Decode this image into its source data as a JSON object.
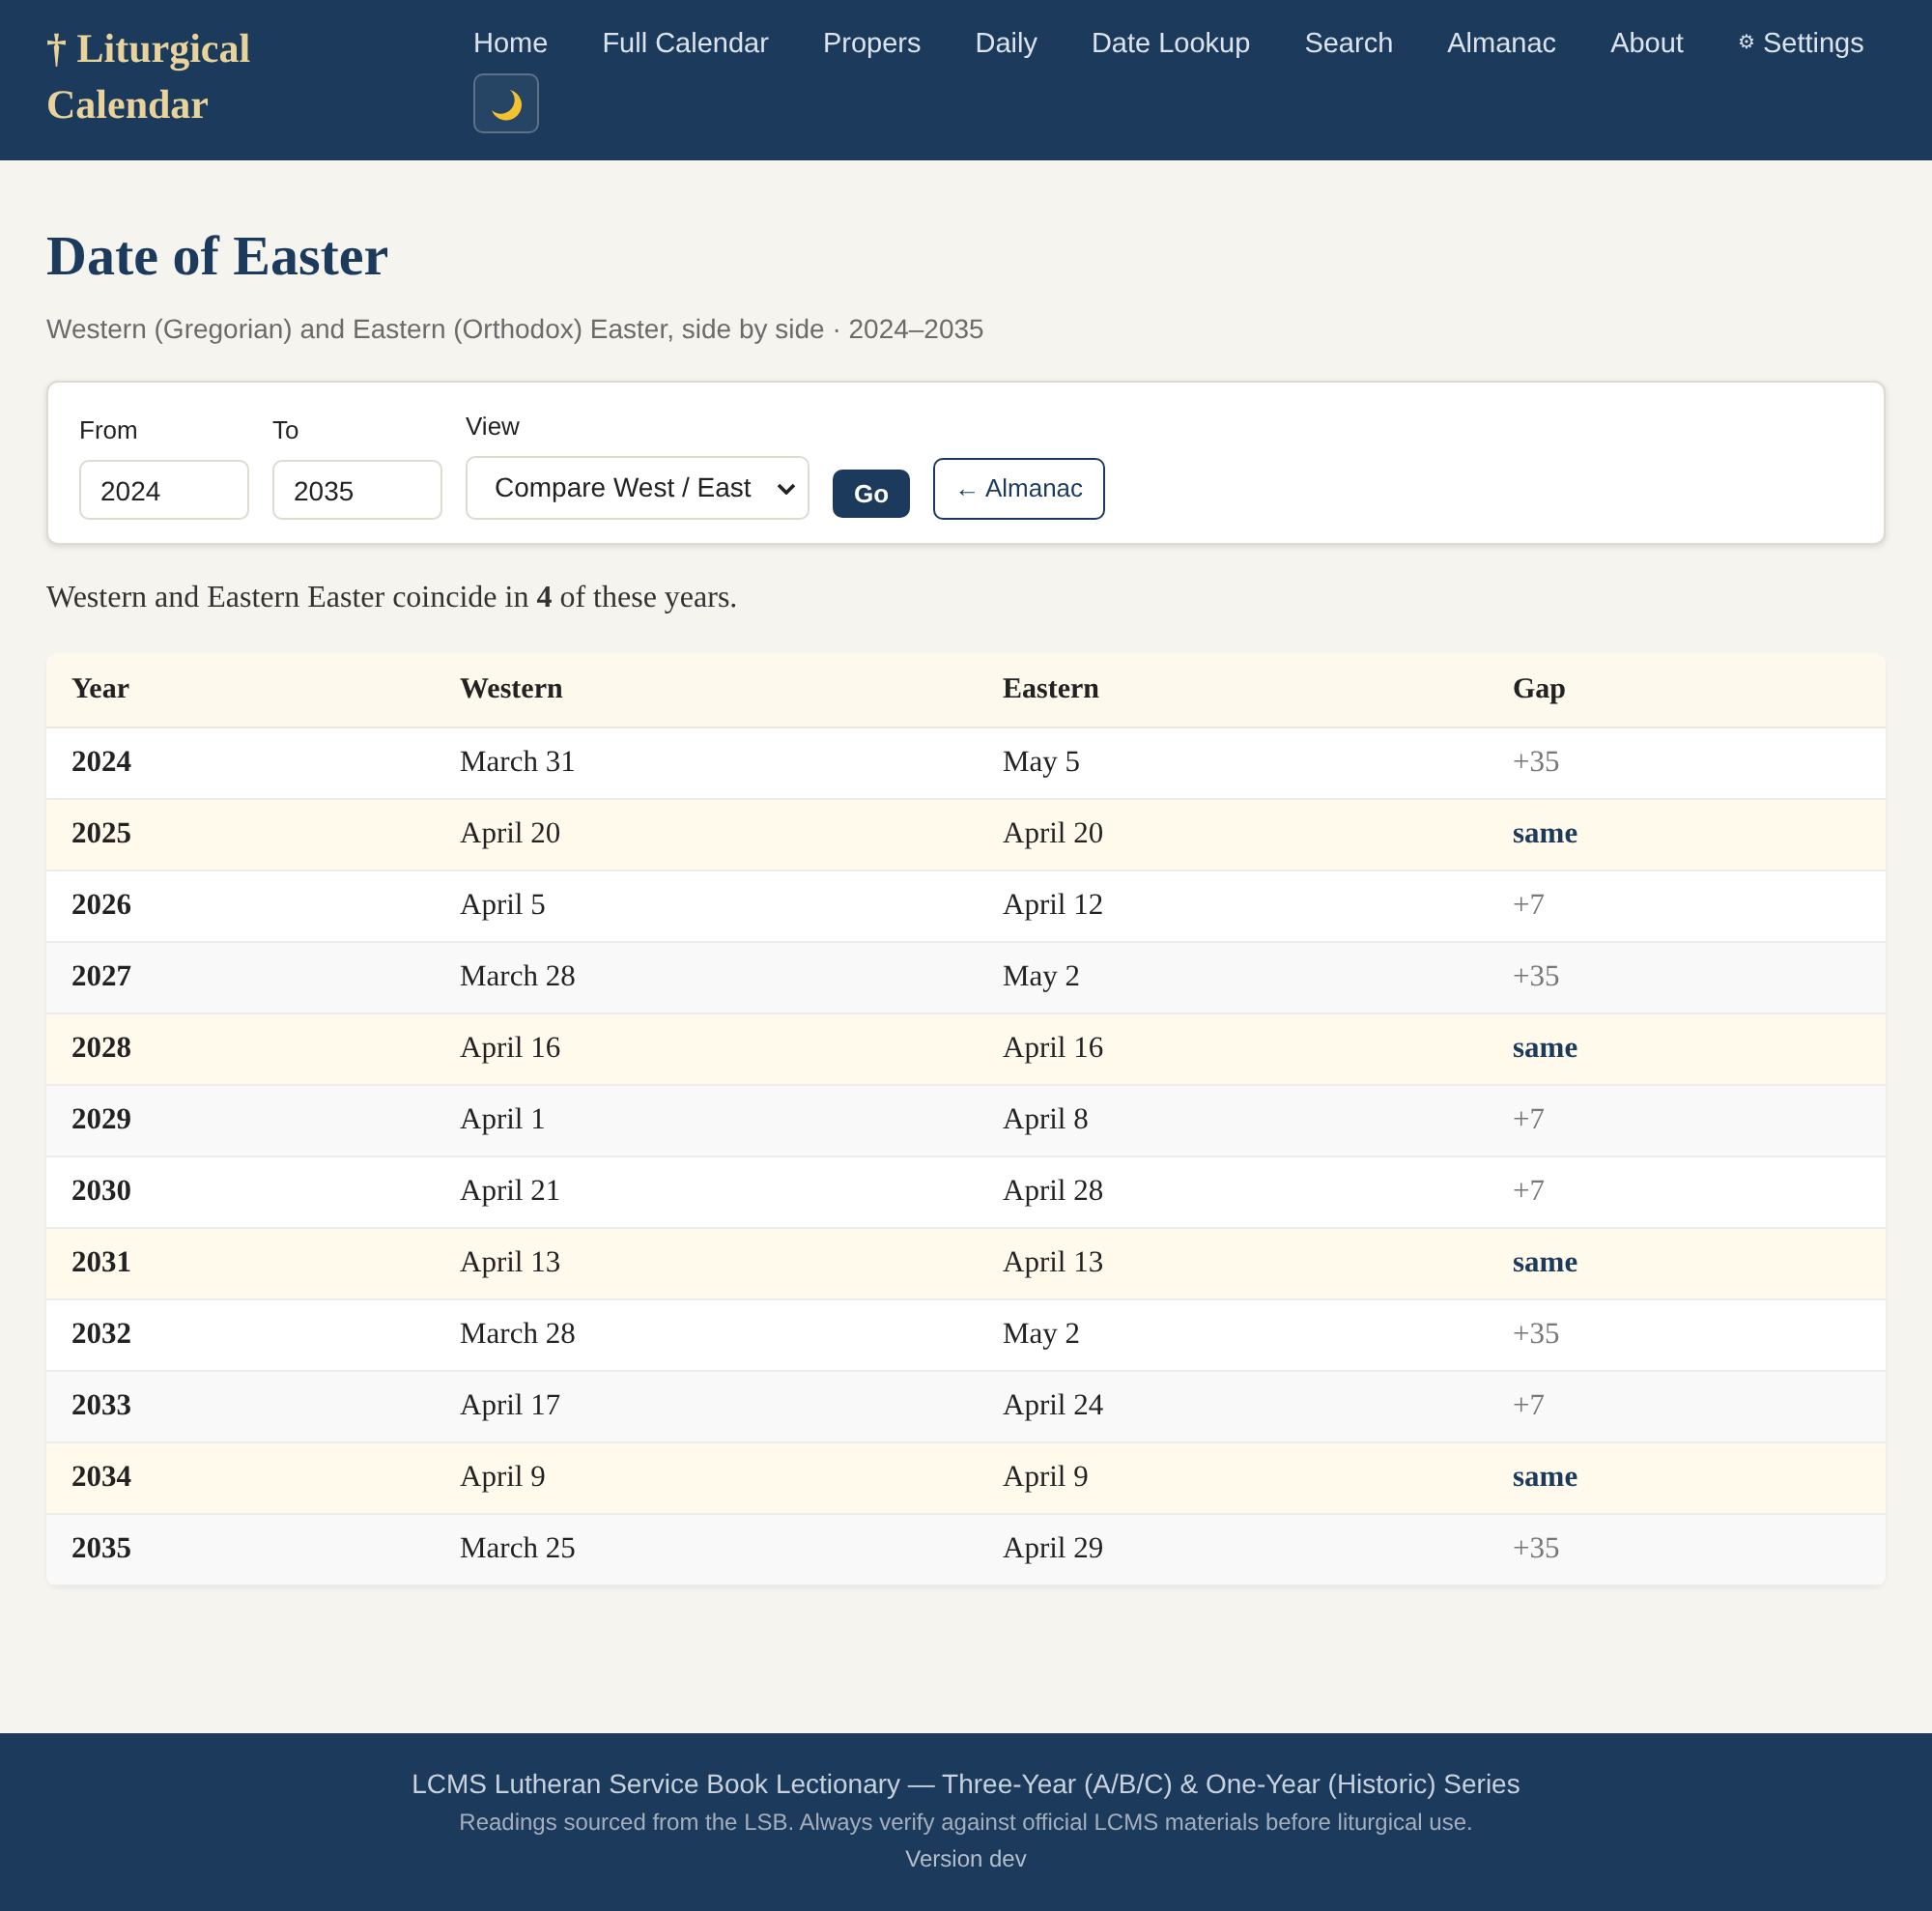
{
  "header": {
    "logo": "† Liturgical Calendar",
    "nav": [
      {
        "label": "Home"
      },
      {
        "label": "Full Calendar"
      },
      {
        "label": "Propers"
      },
      {
        "label": "Daily"
      },
      {
        "label": "Date Lookup"
      },
      {
        "label": "Search"
      },
      {
        "label": "Almanac"
      },
      {
        "label": "About"
      },
      {
        "label": "Settings",
        "icon": "⚙"
      }
    ]
  },
  "page": {
    "title": "Date of Easter",
    "subtitle": "Western (Gregorian) and Eastern (Orthodox) Easter, side by side · 2024–2035"
  },
  "form": {
    "fields": [
      {
        "label": "From",
        "value": "2024"
      },
      {
        "label": "To",
        "value": "2035"
      }
    ],
    "view": {
      "label": "View",
      "value": "Compare West / East"
    },
    "submit": "Go",
    "back_link": "← Almanac"
  },
  "summary": "Western and Eastern Easter coincide in **4** of these years.",
  "table": {
    "columns": [
      "Year",
      "Western",
      "Eastern",
      "Gap"
    ],
    "rows": [
      {
        "year": "2024",
        "western": "March 31",
        "eastern": "May 5",
        "gap": "+35",
        "coincide": false
      },
      {
        "year": "2025",
        "western": "April 20",
        "eastern": "April 20",
        "gap": "same",
        "coincide": true
      },
      {
        "year": "2026",
        "western": "April 5",
        "eastern": "April 12",
        "gap": "+7",
        "coincide": false
      },
      {
        "year": "2027",
        "western": "March 28",
        "eastern": "May 2",
        "gap": "+35",
        "coincide": false
      },
      {
        "year": "2028",
        "western": "April 16",
        "eastern": "April 16",
        "gap": "same",
        "coincide": true
      },
      {
        "year": "2029",
        "western": "April 1",
        "eastern": "April 8",
        "gap": "+7",
        "coincide": false
      },
      {
        "year": "2030",
        "western": "April 21",
        "eastern": "April 28",
        "gap": "+7",
        "coincide": false
      },
      {
        "year": "2031",
        "western": "April 13",
        "eastern": "April 13",
        "gap": "same",
        "coincide": true
      },
      {
        "year": "2032",
        "western": "March 28",
        "eastern": "May 2",
        "gap": "+35",
        "coincide": false
      },
      {
        "year": "2033",
        "western": "April 17",
        "eastern": "April 24",
        "gap": "+7",
        "coincide": false
      },
      {
        "year": "2034",
        "western": "April 9",
        "eastern": "April 9",
        "gap": "same",
        "coincide": true
      },
      {
        "year": "2035",
        "western": "March 25",
        "eastern": "April 29",
        "gap": "+35",
        "coincide": false
      }
    ]
  },
  "footer": {
    "title": "LCMS Lutheran Service Book Lectionary — Three-Year (A/B/C) & One-Year (Historic) Series",
    "note": "Readings sourced from the LSB. Always verify against official LCMS materials before liturgical use.",
    "version": "Version dev"
  }
}
